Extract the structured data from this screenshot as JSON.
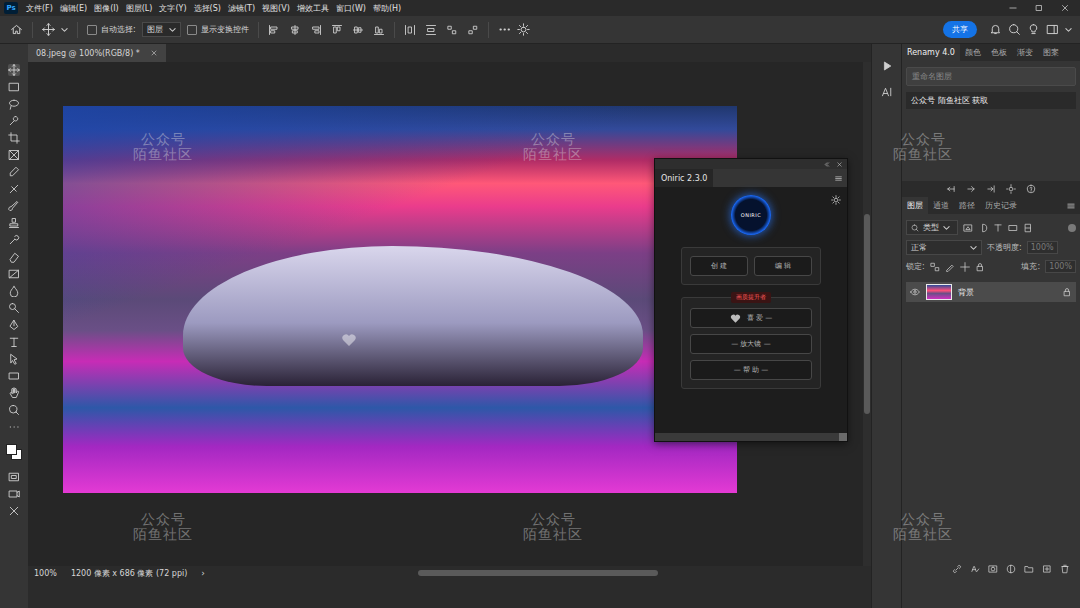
{
  "app": {
    "logo": "Ps"
  },
  "menu": [
    "文件(F)",
    "编辑(E)",
    "图像(I)",
    "图层(L)",
    "文字(Y)",
    "选择(S)",
    "滤镜(T)",
    "视图(V)",
    "增效工具",
    "窗口(W)",
    "帮助(H)"
  ],
  "options_bar": {
    "auto_select": {
      "label": "自动选择:",
      "checked": false
    },
    "target": "图层",
    "show_transform": {
      "label": "显示变换控件",
      "checked": false
    },
    "share": "共享"
  },
  "document": {
    "tab": "08.jpeg @ 100%(RGB/8) *",
    "zoom": "100%",
    "info": "1200 像素 x 686 像素 (72 ppi)",
    "arrow": "›"
  },
  "plugin": {
    "title": "Oniric 2.3.0",
    "logo": "ONIRIC",
    "main_buttons": [
      "创 建",
      "编 辑"
    ],
    "group_label": "画质提升者",
    "group_buttons": [
      {
        "label": "喜 爱 —",
        "heart": true
      },
      {
        "label": "— 放大镜 —",
        "heart": false
      },
      {
        "label": "— 帮 助 —",
        "heart": false
      }
    ]
  },
  "renamy": {
    "tabs": [
      {
        "label": "Renamy 4.0",
        "selected": true
      },
      {
        "label": "颜色",
        "selected": false
      },
      {
        "label": "色板",
        "selected": false
      },
      {
        "label": "渐变",
        "selected": false
      },
      {
        "label": "图案",
        "selected": false
      }
    ],
    "search_placeholder": "重命名图层",
    "items": [
      "公众号 陌鱼社区 获取"
    ]
  },
  "layers_panel": {
    "tabs": [
      {
        "label": "图层",
        "selected": true
      },
      {
        "label": "通道",
        "selected": false
      },
      {
        "label": "路径",
        "selected": false
      },
      {
        "label": "历史记录",
        "selected": false
      }
    ],
    "filter": "类型",
    "blend": "正常",
    "opacity_label": "不透明度:",
    "opacity": {
      "value": "100%",
      "disabled": true
    },
    "lock_label": "锁定:",
    "fill_label": "填充:",
    "fill": {
      "value": "100%",
      "disabled": true
    },
    "layers": [
      {
        "name": "背景",
        "visible": true,
        "locked": true,
        "selected": true
      }
    ]
  },
  "watermark": {
    "lines": [
      "公众号",
      "陌鱼社区"
    ]
  }
}
